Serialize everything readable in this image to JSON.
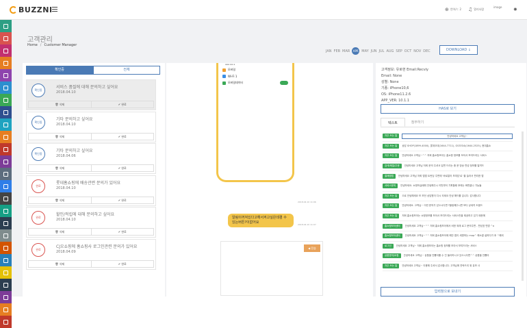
{
  "brand": {
    "name": "BUZZNI"
  },
  "topnav": {
    "lang": "언어/ㄷ 2",
    "alerts": "알리사람",
    "avatar_alt": "image"
  },
  "sidebar_colors": [
    "#2d9f84",
    "#d9534f",
    "#c2306f",
    "#e67e22",
    "#8e44ad",
    "#2c8fcf",
    "#3aa856",
    "#2f4f8f",
    "#1fa3c0",
    "#e67e22",
    "#c0392b",
    "#7d3c98",
    "#5d6d7e",
    "#2f7ee8",
    "#444444",
    "#16a085",
    "#2c3e50",
    "#7f8c8d",
    "#d35400",
    "#2980b9",
    "#e5c107",
    "#2c3e50",
    "#7d3c98",
    "#e67e22",
    "#c0392b"
  ],
  "page": {
    "title": "고객관리",
    "breadcrumb_home": "Home",
    "breadcrumb_sep": "/",
    "breadcrumb_current": "Customer Manager"
  },
  "months": [
    "JAN",
    "FEB",
    "MAR",
    "APR",
    "MAY",
    "JUN",
    "JUL",
    "AUG",
    "SEP",
    "OCT",
    "NOV",
    "DEC"
  ],
  "active_month": "APR",
  "download_label": "DOWNLOAD",
  "left": {
    "tab_pending": "확인중",
    "tab_all": "전체",
    "items": [
      {
        "badge": "확인중",
        "title": "서비스 품질에 대해 문의하고 싶어요",
        "date": "2018.04.10",
        "delete": "삭제",
        "done": "완료"
      },
      {
        "badge": "확인중",
        "title": "기타 문의하고 싶어요",
        "date": "2018.04.10",
        "delete": "삭제",
        "done": "완료"
      },
      {
        "badge": "확인중",
        "title": "기타 문의하고 싶어요",
        "date": "2018.04.06",
        "delete": "삭제",
        "done": "완료"
      },
      {
        "badge": "완료",
        "title": "롯데홈쇼핑에 배송관련 문의가 있어요",
        "date": "2018.04.10",
        "delete": "삭제",
        "done": "완료"
      },
      {
        "badge": "완료",
        "title": "할인/적립에 대해 문의하고 싶어요",
        "date": "2018.04.10",
        "delete": "삭제",
        "done": "완료"
      },
      {
        "badge": "완료",
        "title": "CJ오쇼핑에 홈쇼핑사 로그인관련 문의가 있어요",
        "date": "2018.04.09",
        "delete": "삭제",
        "done": "완료"
      }
    ]
  },
  "chat": {
    "phone_rows": [
      "모바일",
      "Wi-Fi 1",
      "모바일데이터"
    ],
    "ts1": "2018.04.10 11:06",
    "bubble": "알림이꺼져있다고해서켜고싶은데켬 수있는버튼?이없어요",
    "ts2": "2018.04.10 11:07",
    "send": "전송"
  },
  "right": {
    "info": [
      "고객정보: 유로현 Email:Recviy",
      "Email: None",
      "성별: None",
      "기종: iPhone10,6",
      "OS: iPhone11.2.6",
      "APP_VER: 10.1.1"
    ],
    "history_button": "HAS로 보기",
    "tab_text": "텍스트",
    "tab_other": "첨부하기",
    "macros": [
      {
        "tag": "자주 쓰는 말",
        "text": "안녕하세요 고객님~"
      },
      {
        "tag": "자주 쓰는 말",
        "text": "상담 SHOP(1899-4000), 롯데오데(1644-7711), GS오오쇼(1644-2525), 현대홈쇼"
      },
      {
        "tag": "자주 쓰는 말",
        "text": "안녕하세요 고객님~^^ 저희 홈쇼핑모아는 홈쇼핑 정보를 모아서 보여드리는 서비스"
      },
      {
        "tag": "검색/메일/주문",
        "text": "안녕하세요 고객님 저희 문의 주셔서 답변 드리는 중 문 방송 편성 정보를 알려드"
      },
      {
        "tag": "결제방법",
        "text": "안녕하세요 고객님 저희 앱앱 트런딩 주면에 '바로알라 보여담'로 '을 눌러서 편리한 앱"
      },
      {
        "tag": "서비스문의",
        "text": "안녕하세요. 쇼핑하실때에 안녕해주시 이번부터 기획할때 후에는 화면끝나 기능들"
      },
      {
        "tag": "자주 쓰는 말",
        "text": "으로 안녕해세요 또 보던 상담원이 다시 되세요 안녕 해드를 입니다. 감사합니다"
      },
      {
        "tag": "자주 쓰는 말",
        "text": "안녕하세요. 고객님~ 이런 문의가 있으시다면 *할림해주시면 보다 상세히 도움드"
      },
      {
        "tag": "자주 쓰는 말",
        "text": "저희 홈쇼핑모아는 쇼핑정보를 모아서 보여드리는 서비스만을 제공하고 있기 때문에"
      },
      {
        "tag": "홈쇼핑모아센터",
        "text": "안녕하세요 고객님~^^ 저희 홈쇼핑모아에서 비한 외래 로그 문의주면 - 편성표 변경 ^o"
      },
      {
        "tag": "홈쇼핑모아센터",
        "text": "안녕하세요 고객님~^^ 저희 홈쇼핑모아에 해안 앱이 세명하는 mop^ 해소결 설하다가 후 ^해외"
      },
      {
        "tag": "로그인",
        "text": "안녕하세요 고객님~ 저희 홈쇼핑모아는 홈쇼핑 정보를 모아서 보여드리는 서비스"
      },
      {
        "tag": "상품문의/요청",
        "text": "안녕하세요 고객님~ 상품을 안뽑아를 수 진 돌아하시고 있으시다면^^ 상품을 안뽑아"
      },
      {
        "tag": "자주 쓰는 말",
        "text": "안녕하세요 고객님~ 이용해 주셔서 감사합니다. 고객님께 연락드리 위 유보 사"
      }
    ],
    "save_button": "입력창으로 보내기"
  }
}
